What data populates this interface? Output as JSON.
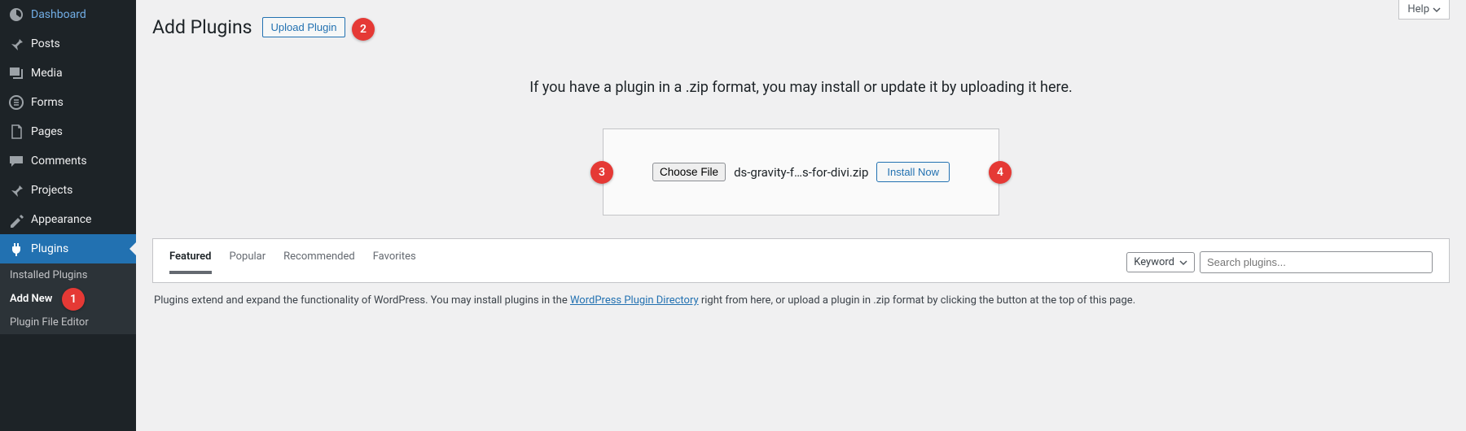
{
  "sidebar": {
    "items": [
      {
        "label": "Dashboard"
      },
      {
        "label": "Posts"
      },
      {
        "label": "Media"
      },
      {
        "label": "Forms"
      },
      {
        "label": "Pages"
      },
      {
        "label": "Comments"
      },
      {
        "label": "Projects"
      },
      {
        "label": "Appearance"
      },
      {
        "label": "Plugins"
      }
    ],
    "submenu": {
      "installed": "Installed Plugins",
      "add_new": "Add New",
      "editor": "Plugin File Editor"
    }
  },
  "header": {
    "help": "Help"
  },
  "page": {
    "title": "Add Plugins",
    "upload_btn": "Upload Plugin",
    "upload_msg": "If you have a plugin in a .zip format, you may install or update it by uploading it here.",
    "choose_file": "Choose File",
    "file_name": "ds-gravity-f…s-for-divi.zip",
    "install_now": "Install Now"
  },
  "steps": {
    "s1": "1",
    "s2": "2",
    "s3": "3",
    "s4": "4"
  },
  "filter": {
    "tabs": {
      "featured": "Featured",
      "popular": "Popular",
      "recommended": "Recommended",
      "favorites": "Favorites"
    },
    "keyword": "Keyword",
    "search_placeholder": "Search plugins..."
  },
  "description": {
    "pre": "Plugins extend and expand the functionality of WordPress. You may install plugins in the ",
    "link": "WordPress Plugin Directory",
    "post": " right from here, or upload a plugin in .zip format by clicking the button at the top of this page."
  }
}
